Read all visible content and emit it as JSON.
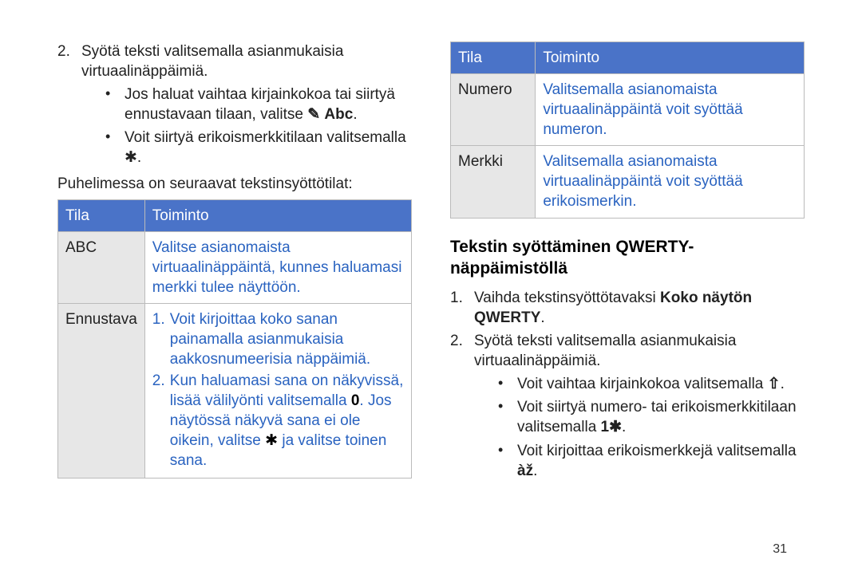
{
  "left": {
    "item2_num": "2.",
    "item2_text": "Syötä teksti valitsemalla asianmukaisia virtuaalinäppäimiä.",
    "b1_pre": "Jos haluat vaihtaa kirjainkokoa tai siirtyä ennustavaan tilaan, valitse ",
    "b1_abc": "Abc",
    "b1_post": ".",
    "b2_pre": "Voit siirtyä erikoismerkkitilaan valitsemalla ",
    "b2_post": ".",
    "list_intro": "Puhelimessa on seuraavat tekstinsyöttötilat:",
    "table": {
      "h1": "Tila",
      "h2": "Toiminto",
      "r1c1": "ABC",
      "r1c2": "Valitse asianomaista virtuaalinäppäintä, kunnes haluamasi merkki tulee näyttöön.",
      "r2c1": "Ennustava",
      "r2_1_n": "1.",
      "r2_1_t": "Voit kirjoittaa koko sanan painamalla asianmukaisia aakkosnumeerisia näppäimiä.",
      "r2_2_n": "2.",
      "r2_2_pre": "Kun haluamasi sana on näkyvissä, lisää välilyönti valitsemalla ",
      "r2_2_zero": "0",
      "r2_2_mid": ". Jos näytössä näkyvä sana ei ole oikein, valitse ",
      "r2_2_post": " ja valitse toinen sana."
    }
  },
  "right": {
    "table": {
      "h1": "Tila",
      "h2": "Toiminto",
      "r1c1": "Numero",
      "r1c2": "Valitsemalla asianomaista virtuaalinäppäintä voit syöttää numeron.",
      "r2c1": "Merkki",
      "r2c2": "Valitsemalla asianomaista virtuaalinäppäintä voit syöttää erikoismerkin."
    },
    "heading": "Tekstin syöttäminen QWERTY-näppäimistöllä",
    "i1_num": "1.",
    "i1_pre": "Vaihda tekstinsyöttötavaksi ",
    "i1_bold": "Koko näytön QWERTY",
    "i1_post": ".",
    "i2_num": "2.",
    "i2_text": "Syötä teksti valitsemalla asianmukaisia virtuaalinäppäimiä.",
    "b1_pre": "Voit vaihtaa kirjainkokoa valitsemalla ",
    "b1_post": ".",
    "b2_pre": "Voit siirtyä numero- tai erikoismerkkitilaan valitsemalla ",
    "b2_post": ".",
    "b3_pre": "Voit kirjoittaa erikoismerkkejä valitsemalla ",
    "b3_post": "."
  },
  "page_number": "31"
}
